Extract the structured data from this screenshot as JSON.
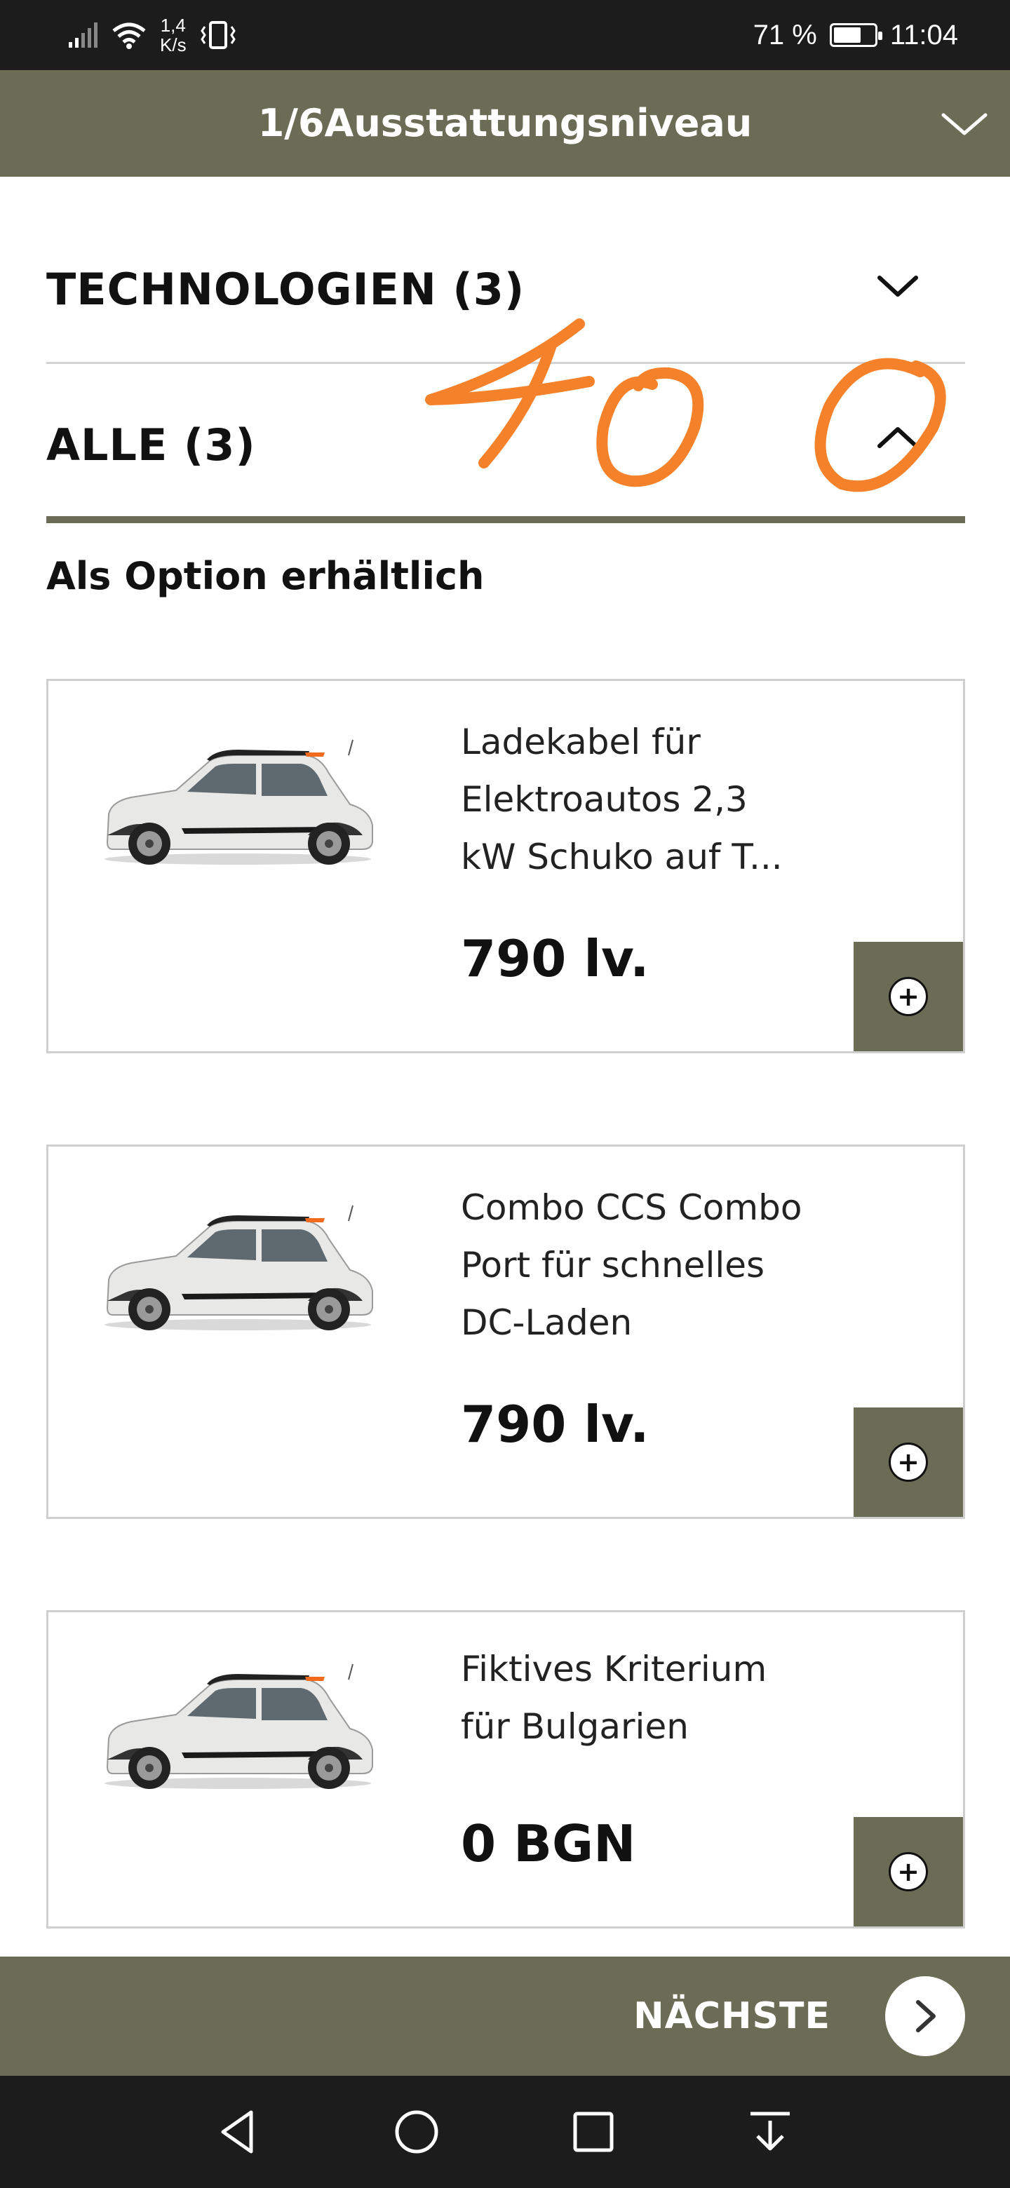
{
  "status_bar": {
    "speed_value": "1,4",
    "speed_unit": "K/s",
    "battery_percent": "71 %",
    "battery_level": 0.71,
    "time": "11:04"
  },
  "header": {
    "title": "1/6Ausstattungsniveau",
    "toggle_icon": "chevron-down-icon"
  },
  "sections": [
    {
      "label": "TECHNOLOGIEN (3)",
      "state": "collapsed",
      "icon": "chevron-down-icon"
    },
    {
      "label": "ALLE (3)",
      "state": "expanded",
      "icon": "chevron-up-icon"
    }
  ],
  "subheading": "Als Option erhältlich",
  "options": [
    {
      "title": "Ladekabel für Elektroautos 2,3 kW Schuko auf T...",
      "lines": [
        "Ladekabel für",
        "Elektroautos 2,3",
        "kW Schuko auf T..."
      ],
      "price": "790 lv.",
      "add_icon": "plus-circle-icon"
    },
    {
      "title": "Combo CCS Combo Port für schnelles DC-Laden",
      "lines": [
        "Combo CCS Combo",
        "Port für schnelles",
        "DC-Laden"
      ],
      "price": "790 lv.",
      "add_icon": "plus-circle-icon"
    },
    {
      "title": "Fiktives Kriterium für Bulgarien",
      "lines": [
        "Fiktives Kriterium",
        "für Bulgarien"
      ],
      "price": "0 BGN",
      "add_icon": "plus-circle-icon"
    }
  ],
  "annotation": {
    "text": "400",
    "color": "#f5822a"
  },
  "action_bar": {
    "next_label": "NÄCHSTE",
    "next_icon": "chevron-right-icon"
  },
  "colors": {
    "brand_olive": "#6b6c55",
    "dark_bar": "#1c1c1c",
    "card_border": "#cfcfcf",
    "annotation_orange": "#f5822a"
  },
  "nav_bar": {
    "icons": [
      "back-triangle-icon",
      "home-circle-icon",
      "recents-square-icon",
      "notification-pull-icon"
    ]
  }
}
